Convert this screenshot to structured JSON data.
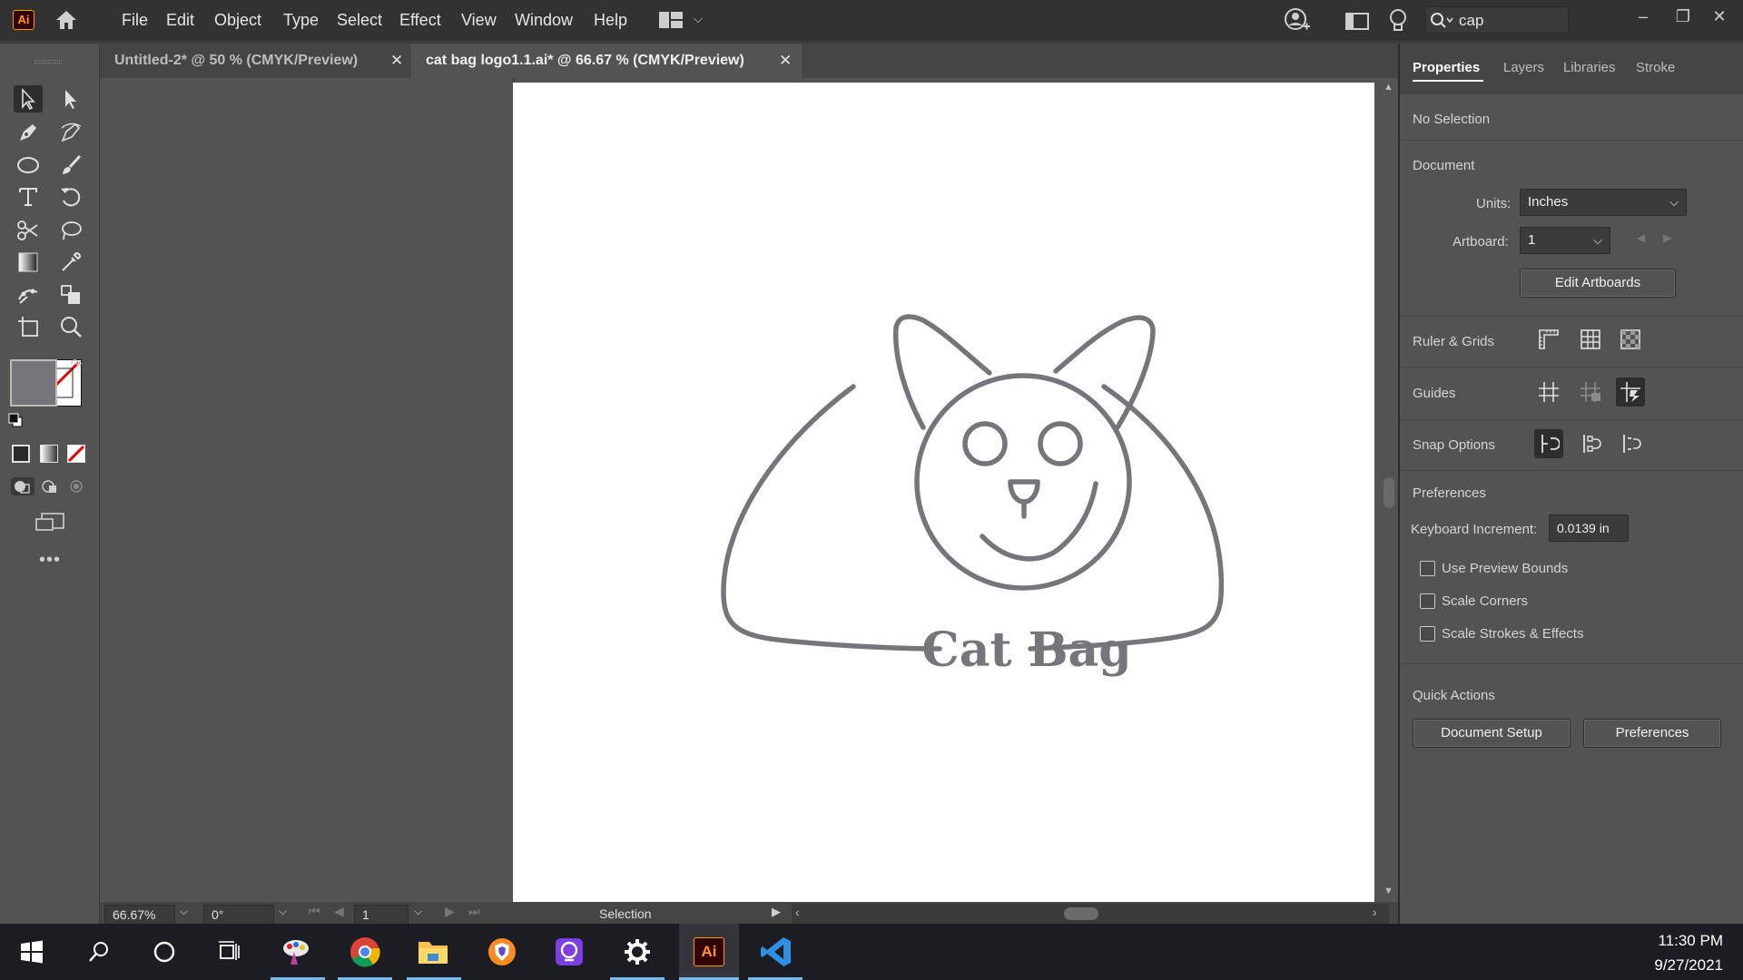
{
  "app": {
    "logo": "Ai"
  },
  "menu": [
    "File",
    "Edit",
    "Object",
    "Type",
    "Select",
    "Effect",
    "View",
    "Window",
    "Help"
  ],
  "search": {
    "value": "cap"
  },
  "tabs": [
    {
      "label": "Untitled-2* @ 50 % (CMYK/Preview)",
      "active": false
    },
    {
      "label": "cat bag logo1.1.ai* @ 66.67 % (CMYK/Preview)",
      "active": true
    }
  ],
  "artwork": {
    "logo_text": "Cat Bag",
    "stroke_color": "#76767a"
  },
  "status": {
    "zoom": "66.67%",
    "rotation": "0°",
    "artboard": "1",
    "tool": "Selection"
  },
  "panel": {
    "tabs": [
      "Properties",
      "Layers",
      "Libraries",
      "Stroke"
    ],
    "selection": "No Selection",
    "document": {
      "heading": "Document",
      "units_label": "Units:",
      "units_value": "Inches",
      "artboard_label": "Artboard:",
      "artboard_value": "1",
      "edit_artboards": "Edit Artboards"
    },
    "ruler_grids": "Ruler & Grids",
    "guides": "Guides",
    "snap_options": "Snap Options",
    "preferences": {
      "heading": "Preferences",
      "keyboard_increment_label": "Keyboard Increment:",
      "keyboard_increment_value": "0.0139 in",
      "checkboxes": [
        "Use Preview Bounds",
        "Scale Corners",
        "Scale Strokes & Effects"
      ]
    },
    "quick_actions": {
      "heading": "Quick Actions",
      "document_setup": "Document Setup",
      "preferences": "Preferences"
    }
  },
  "taskbar": {
    "time": "11:30 PM",
    "date": "9/27/2021",
    "accent": "#76b9ed"
  }
}
